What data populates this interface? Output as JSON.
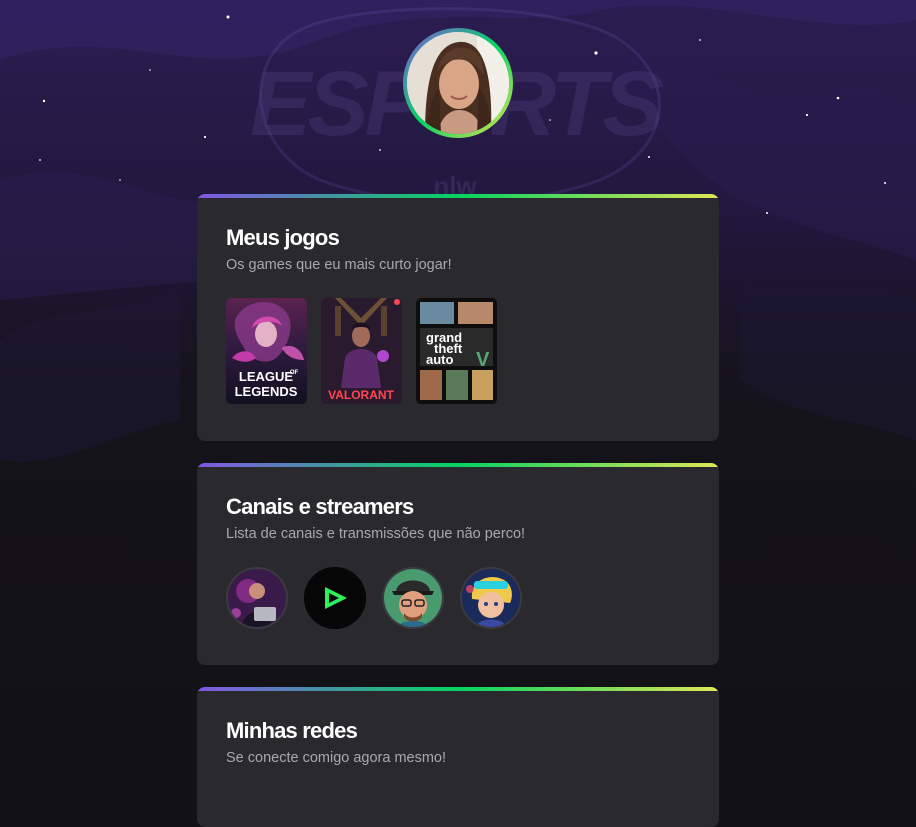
{
  "background": {
    "watermark": "ESPORTS",
    "watermark_sub": "nlw"
  },
  "profile": {
    "avatar": "profile-photo"
  },
  "sections": {
    "games": {
      "title": "Meus jogos",
      "subtitle": "Os games que eu mais curto jogar!",
      "items": [
        {
          "name": "League of Legends",
          "label_top": "LEAGUE",
          "label_of": "OF",
          "label_bottom": "LEGENDS"
        },
        {
          "name": "Valorant",
          "label": "VALORANT"
        },
        {
          "name": "Grand Theft Auto V",
          "label_1": "grand",
          "label_2": "theft",
          "label_3": "auto"
        }
      ]
    },
    "channels": {
      "title": "Canais e streamers",
      "subtitle": "Lista de canais e transmissões que não perco!",
      "items": [
        {
          "icon": "streamer-1-avatar"
        },
        {
          "icon": "livestream-play-icon"
        },
        {
          "icon": "streamer-3-avatar"
        },
        {
          "icon": "streamer-4-avatar"
        }
      ]
    },
    "social": {
      "title": "Minhas redes",
      "subtitle": "Se conecte comigo agora mesmo!"
    }
  },
  "colors": {
    "gradient_start": "#8257e5",
    "gradient_mid": "#04d361",
    "gradient_end": "#e1e655",
    "card_bg": "#29292e",
    "page_bg": "#121214"
  }
}
